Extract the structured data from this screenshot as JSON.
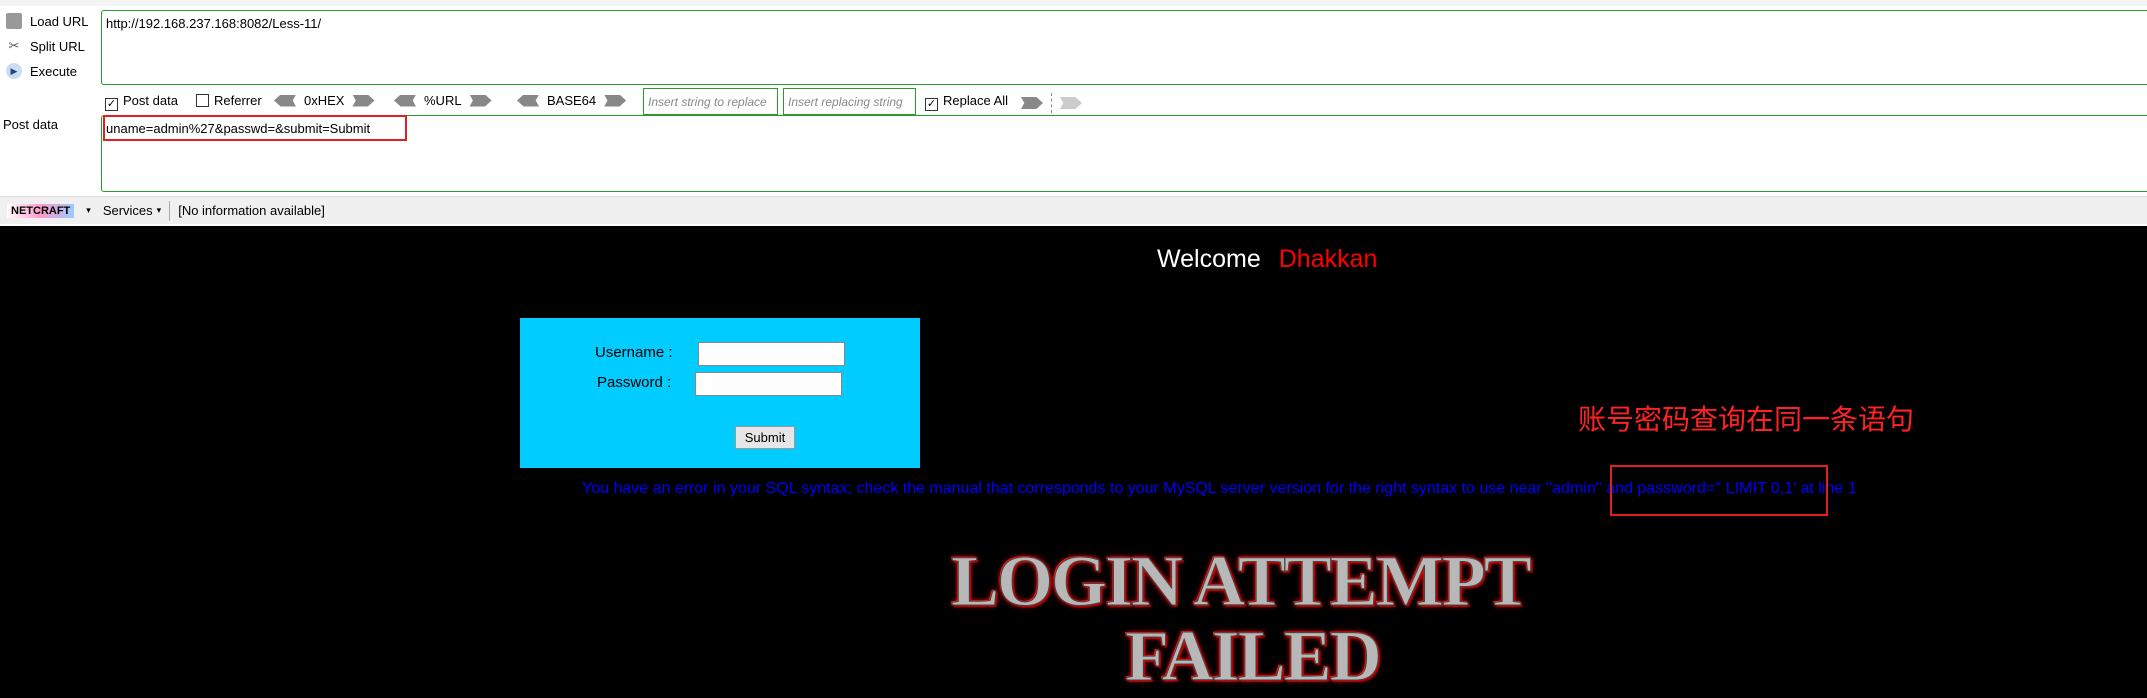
{
  "hackbar": {
    "actions": [
      {
        "label": "Load URL",
        "icon": "load-url-icon"
      },
      {
        "label": "Split URL",
        "icon": "scissors-icon"
      },
      {
        "label": "Execute",
        "icon": "play-icon"
      }
    ],
    "url_value": "http://192.168.237.168:8082/Less-11/",
    "post_data_checkbox": "Post data",
    "referrer_checkbox": "Referrer",
    "hex": "0xHEX",
    "urlenc": "%URL",
    "base64": "BASE64",
    "replace_placeholder": "Insert string to replace",
    "replacing_placeholder": "Insert replacing string",
    "replace_all": "Replace All",
    "post_label": "Post data",
    "post_value": "uname=admin%27&passwd=&submit=Submit",
    "netcraft": "NETCRAFT",
    "services": "Services",
    "info": "[No information available]"
  },
  "page": {
    "welcome": "Welcome",
    "name": "Dhakkan",
    "username_label": "Username :",
    "password_label": "Password :",
    "submit": "Submit",
    "annotation": "账号密码查询在同一条语句",
    "error": "You have an error in your SQL syntax; check the manual that corresponds to your MySQL server version for the right syntax to use near ''admin'' and password='' LIMIT 0,1' at line 1",
    "banner_line1": "LOGIN ATTEMPT",
    "banner_line2": "FAILED"
  }
}
